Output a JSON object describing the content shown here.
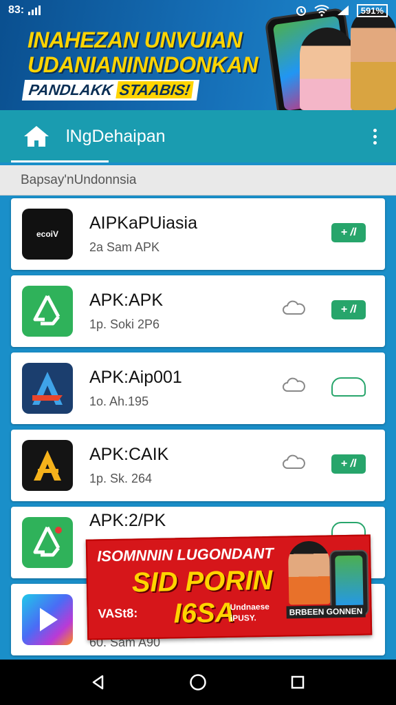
{
  "status_bar": {
    "time": "83:",
    "battery": "591%"
  },
  "top_ad": {
    "line1": "INAHEZAN UNVUIAN",
    "line2": "UDANIANINNDONKAN",
    "line3a": "PANDLAKK",
    "line3b": "STAABIS!"
  },
  "app_bar": {
    "title": "lNgDehaipan",
    "home_icon": "home-icon",
    "menu_icon": "more-vertical-icon"
  },
  "section_header": "Bapsay'nUndonnsia",
  "apps": [
    {
      "name": "AIPKaPUiasia",
      "sub": "2a  Sam APK",
      "icon": "black-logo",
      "icon_text": "ecoiV",
      "button": "+ /l",
      "cloud": false,
      "button_style": "filled"
    },
    {
      "name": "APK:APK",
      "sub": "1p. Soki  2P6",
      "icon": "green-recycle",
      "button": "+ /l",
      "cloud": true,
      "button_style": "filled"
    },
    {
      "name": "APK:Aip001",
      "sub": "1o. Ah.195",
      "icon": "blue-a",
      "button": "",
      "cloud": true,
      "button_style": "outline"
    },
    {
      "name": "APK:CAIK",
      "sub": "1p. Sk. 264",
      "icon": "gold-a",
      "button": "+ /l",
      "cloud": true,
      "button_style": "filled"
    },
    {
      "name": "APK:2/PK",
      "sub": "",
      "icon": "green-2",
      "button": "",
      "cloud": false,
      "button_style": "outline"
    },
    {
      "name": "",
      "sub": "60. Sam A90",
      "icon": "gradient-play",
      "button": "",
      "cloud": false,
      "button_style": "none"
    }
  ],
  "bottom_ad": {
    "line1": "ISOMNNIN LUGONDANT",
    "line2": "SID PORIN",
    "line3": "VASt8:",
    "line4": "I6SA",
    "line5a": "Undnaese",
    "line5b": "iPUSY.",
    "tag": "BRBEEN GONNEN"
  },
  "colors": {
    "primary": "#1a9cb0",
    "accent": "#27a56b",
    "banner_yellow": "#ffd400"
  }
}
